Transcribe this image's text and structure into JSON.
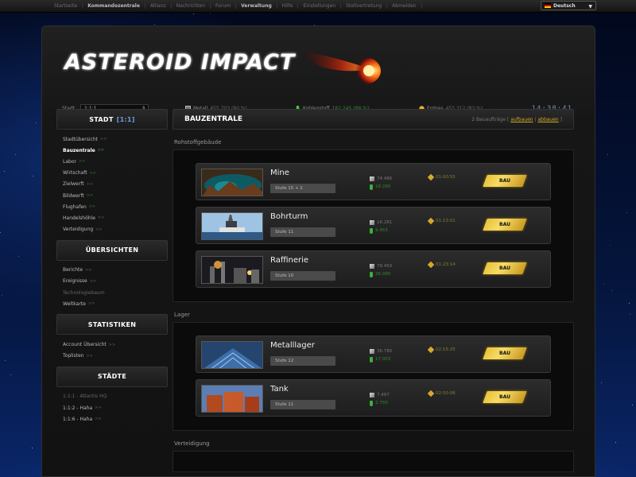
{
  "topnav": {
    "items": [
      {
        "label": "Startseite",
        "active": false
      },
      {
        "label": "Kommandozentrale",
        "active": true
      },
      {
        "label": "Allianz",
        "active": false
      },
      {
        "label": "Nachrichten",
        "active": false
      },
      {
        "label": "Forum",
        "active": false
      },
      {
        "label": "Verwaltung",
        "active": true
      },
      {
        "label": "Hilfe",
        "active": false
      },
      {
        "label": "Einstellungen",
        "active": false
      },
      {
        "label": "Stellvertretung",
        "active": false
      },
      {
        "label": "Abmelden",
        "active": false
      }
    ],
    "language": "Deutsch"
  },
  "logo": {
    "text": "ASTEROID IMPACT"
  },
  "resources": {
    "stadt_label": "Stadt",
    "stadt_value": "1:1:1",
    "metall_label": "Metall",
    "metall_value": "455.703 (80 %)",
    "kristall_label": "Kohlenstoff",
    "kristall_value": "182.245 (88 %)",
    "energie_label": "Erdgas",
    "energie_value": "455.312 (83 %)",
    "clock": "14:38:41"
  },
  "sidebar": {
    "stadt": {
      "title": "STADT",
      "count": "[1:1]",
      "items": [
        {
          "label": "Stadtübersicht",
          "ext": ">>",
          "active": false,
          "dim": false
        },
        {
          "label": "Bauzentrale",
          "ext": ">>",
          "active": true,
          "dim": false
        },
        {
          "label": "Labor",
          "ext": ">>",
          "active": false,
          "dim": false
        },
        {
          "label": "Wirtschaft",
          "ext": ">>",
          "active": false,
          "dim": false
        },
        {
          "label": "Zielwerft",
          "ext": ">>",
          "active": false,
          "dim": false
        },
        {
          "label": "Bildwerft",
          "ext": ">>",
          "active": false,
          "dim": false
        },
        {
          "label": "Flughafen",
          "ext": ">>",
          "active": false,
          "dim": false
        },
        {
          "label": "Handelshöhle",
          "ext": ">>",
          "active": false,
          "dim": false
        },
        {
          "label": "Verteidigung",
          "ext": ">>",
          "active": false,
          "dim": false
        }
      ]
    },
    "uebersichten": {
      "title": "ÜBERSICHTEN",
      "items": [
        {
          "label": "Berichte",
          "ext": ">>",
          "active": false,
          "dim": false
        },
        {
          "label": "Ereignisse",
          "ext": ">>",
          "active": false,
          "dim": false
        },
        {
          "label": "Technologiebaum",
          "ext": "",
          "active": false,
          "dim": true
        },
        {
          "label": "Weltkarte",
          "ext": ">>",
          "active": false,
          "dim": false
        }
      ]
    },
    "statistiken": {
      "title": "STATISTIKEN",
      "items": [
        {
          "label": "Account Übersicht",
          "ext": ">>",
          "active": false,
          "dim": false
        },
        {
          "label": "Toplisten",
          "ext": ">>",
          "active": false,
          "dim": false
        }
      ]
    },
    "staedte": {
      "title": "STÄDTE",
      "items": [
        {
          "label": "1:1:1 - Atlantis HQ",
          "ext": "",
          "active": false,
          "dim": true
        },
        {
          "label": "1:1:2 - Haha",
          "ext": ">>",
          "active": false,
          "dim": false
        },
        {
          "label": "1:1:6 - Haha",
          "ext": ">>",
          "active": false,
          "dim": false
        }
      ]
    }
  },
  "content": {
    "title": "BAUZENTRALE",
    "queue_text": "2 Bauaufträge [",
    "queue_link1": "aufbauen",
    "queue_sep": "|",
    "queue_link2": "abbauen",
    "queue_end": "]",
    "sections": [
      {
        "label": "Rohstoffgebäude",
        "buildings": [
          {
            "name": "Mine",
            "stufe": "Stufe 15 + 2",
            "metall": "74.486",
            "kohlenstoff": "18.290",
            "zeit": "01:00:55",
            "button": "BAU"
          },
          {
            "name": "Bohrturm",
            "stufe": "Stufe 11",
            "metall": "16.281",
            "kohlenstoff": "9.453",
            "zeit": "01:13:01",
            "button": "BAU"
          },
          {
            "name": "Raffinerie",
            "stufe": "Stufe 10",
            "metall": "79.450",
            "kohlenstoff": "26.090",
            "zeit": "01:23:14",
            "button": "BAU"
          }
        ]
      },
      {
        "label": "Lager",
        "buildings": [
          {
            "name": "Metalllager",
            "stufe": "Stufe 12",
            "metall": "36.780",
            "kohlenstoff": "17.003",
            "zeit": "02:15:25",
            "button": "BAU"
          },
          {
            "name": "Tank",
            "stufe": "Stufe 11",
            "metall": "7.497",
            "kohlenstoff": "2.750",
            "zeit": "02:50:06",
            "button": "BAU"
          }
        ]
      },
      {
        "label": "Verteidigung",
        "buildings": []
      }
    ]
  },
  "colors": {
    "accent_gold": "#d4a92b",
    "link_green": "#3b7a3b",
    "sidebar_count": "#6aa0d8"
  }
}
